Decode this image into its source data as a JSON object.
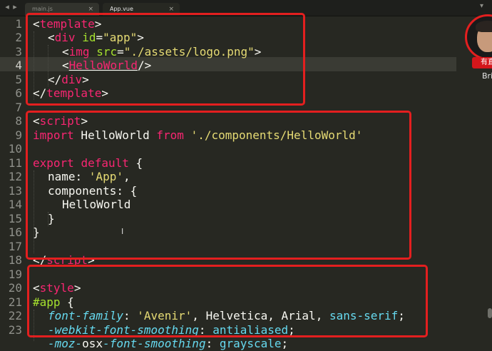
{
  "tabs": [
    {
      "label": "main.js",
      "active": false
    },
    {
      "label": "App.vue",
      "active": true
    }
  ],
  "tab_close_glyph": "×",
  "nav_back_glyph": "◂",
  "nav_forward_glyph": "▸",
  "tab_dropdown_glyph": "▾",
  "line_numbers": [
    "1",
    "2",
    "3",
    "4",
    "5",
    "6",
    "7",
    "8",
    "9",
    "10",
    "11",
    "12",
    "13",
    "14",
    "15",
    "16",
    "17",
    "18",
    "19",
    "20",
    "21",
    "22",
    "23"
  ],
  "code": {
    "l1": {
      "open": "<",
      "tag": "template",
      "close": ">"
    },
    "l2": {
      "open": "<",
      "tag": "div",
      "attr": "id",
      "eq": "=",
      "val": "\"app\"",
      "close": ">"
    },
    "l3": {
      "open": "<",
      "tag": "img",
      "attr": "src",
      "eq": "=",
      "val": "\"./assets/logo.png\"",
      "close": ">"
    },
    "l4": {
      "open": "<",
      "tag": "HelloWorld",
      "close": "/>"
    },
    "l5": {
      "open": "</",
      "tag": "div",
      "close": ">"
    },
    "l6": {
      "open": "</",
      "tag": "template",
      "close": ">"
    },
    "l8": {
      "open": "<",
      "tag": "script",
      "close": ">"
    },
    "l9": {
      "kw1": "import",
      "ident": " HelloWorld ",
      "kw2": "from",
      "sp": " ",
      "str": "'./components/HelloWorld'"
    },
    "l11": {
      "kw1": "export",
      "sp": " ",
      "kw2": "default",
      "rest": " {"
    },
    "l12": {
      "key": "name",
      "colon": ": ",
      "str": "'App'",
      "comma": ","
    },
    "l13": {
      "key": "components",
      "rest": ": {"
    },
    "l14": {
      "ident": "HelloWorld"
    },
    "l15": {
      "brace": "}"
    },
    "l16": {
      "brace": "}"
    },
    "l17": {
      "open": "</",
      "tag": "script",
      "close": ">"
    },
    "l19": {
      "open": "<",
      "tag": "style",
      "close": ">"
    },
    "l20": {
      "sel": "#app",
      "rest": " {"
    },
    "l21": {
      "prop": "font-family",
      "colon": ": ",
      "str": "'Avenir'",
      "rest": ", Helvetica, Arial, ",
      "kw": "sans-serif",
      "end": ";"
    },
    "l22": {
      "prop": "-webkit-font-smoothing",
      "colon": ": ",
      "kw": "antialiased",
      "end": ";"
    },
    "l23": {
      "prop1": "-moz-",
      "plain": "osx",
      "prop2": "-font-smoothing",
      "colon": ": ",
      "kw": "grayscale",
      "end": ";"
    }
  },
  "avatar": {
    "badge": "有直",
    "name": "Bri"
  },
  "text_cursor_glyph": "I"
}
